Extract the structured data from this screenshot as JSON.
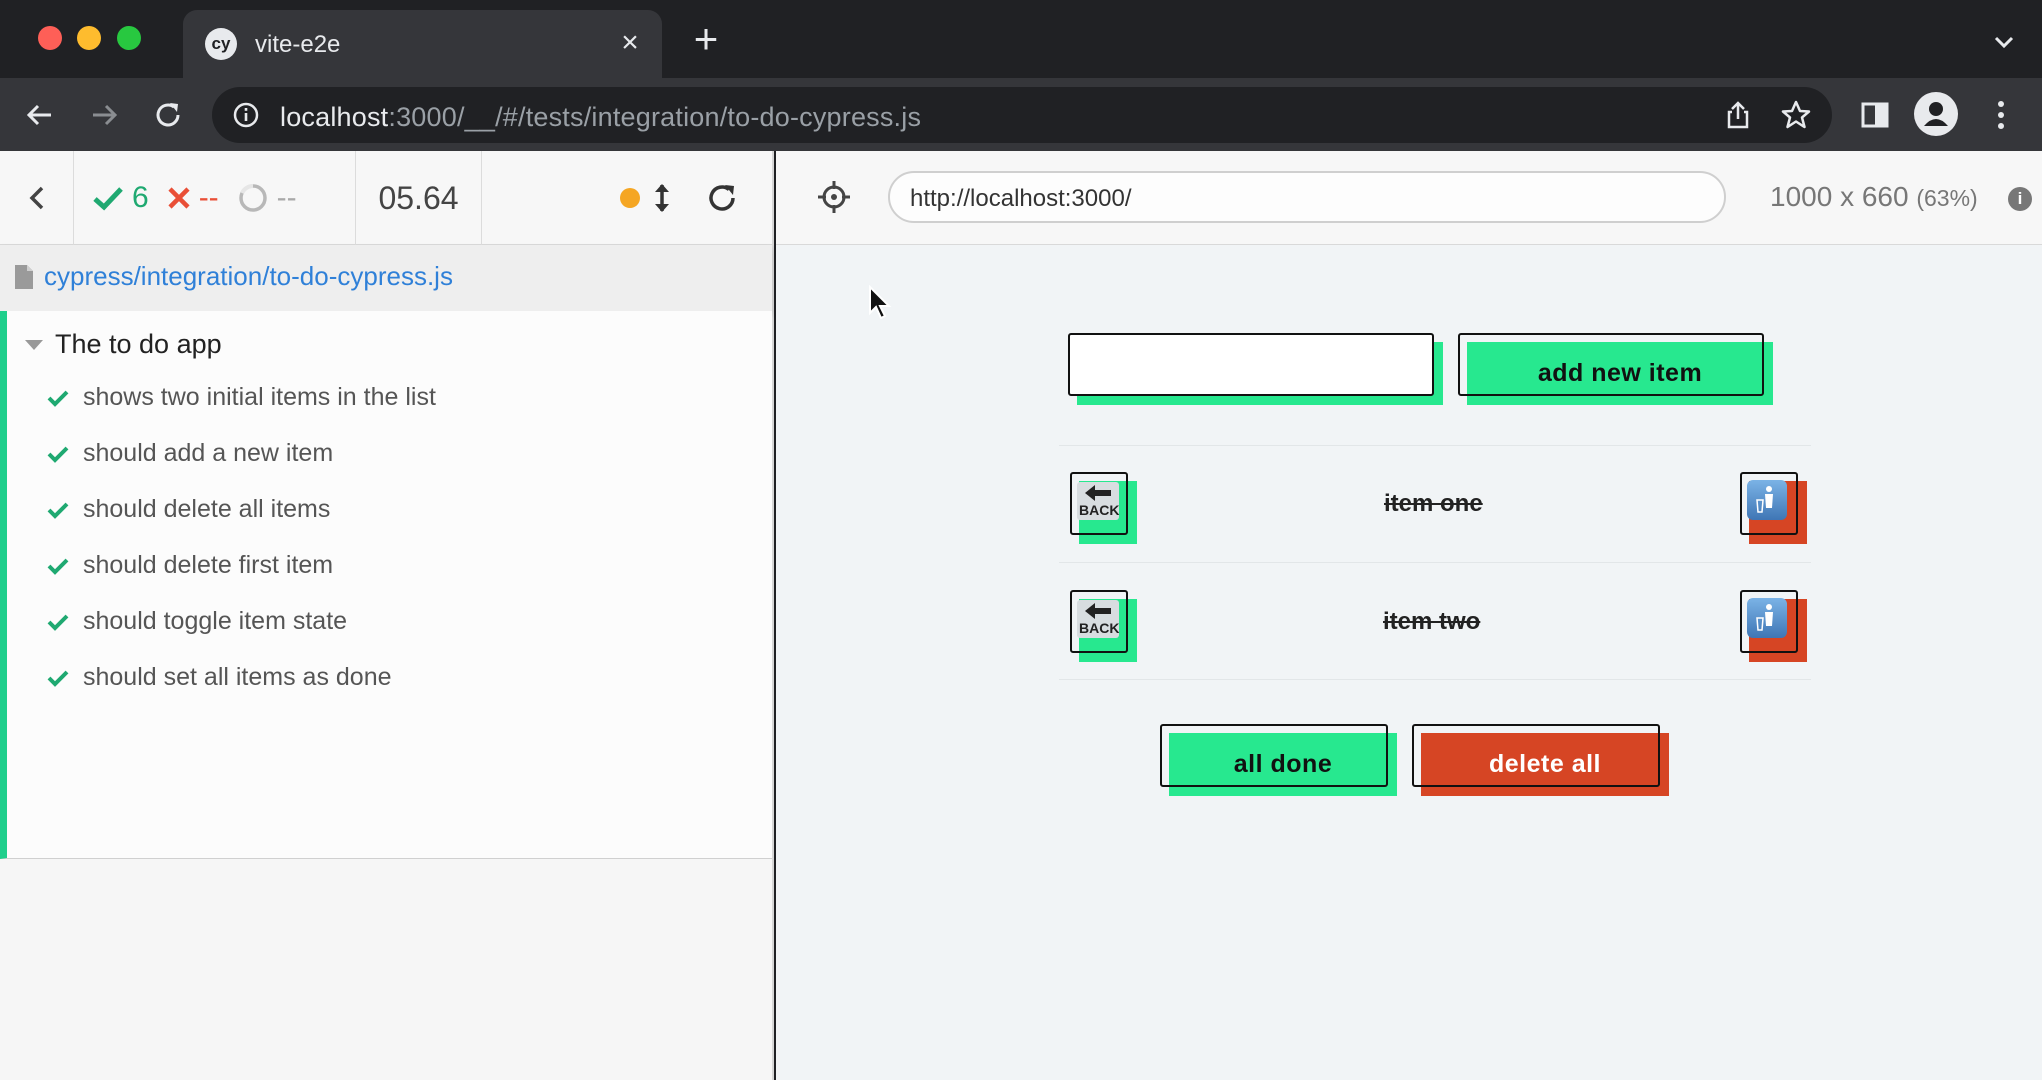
{
  "browser": {
    "tab_title": "vite-e2e",
    "tab_favicon_text": "cy",
    "url_host": "localhost",
    "url_rest": ":3000/__/#/tests/integration/to-do-cypress.js"
  },
  "runner": {
    "passed": "6",
    "failed": "--",
    "pending": "--",
    "duration": "05.64",
    "spec_path": "cypress/integration/to-do-cypress.js",
    "suite_title": "The to do app",
    "tests": [
      {
        "title": "shows two initial items in the list",
        "state": "passed"
      },
      {
        "title": "should add a new item",
        "state": "passed"
      },
      {
        "title": "should delete all items",
        "state": "passed"
      },
      {
        "title": "should delete first item",
        "state": "passed"
      },
      {
        "title": "should toggle item state",
        "state": "passed"
      },
      {
        "title": "should set all items as done",
        "state": "passed"
      }
    ],
    "aut_url": "http://localhost:3000/",
    "viewport_size": "1000 x 660",
    "viewport_scale": "(63%)"
  },
  "app": {
    "new_item_value": "",
    "add_button_label": "add new item",
    "items": [
      {
        "text": "item one",
        "done": true,
        "back_label": "BACK"
      },
      {
        "text": "item two",
        "done": true,
        "back_label": "BACK"
      }
    ],
    "all_done_label": "all done",
    "delete_all_label": "delete all"
  },
  "colors": {
    "pass_green": "#1fa971",
    "fail_red": "#e94f37",
    "app_green": "#27e88f",
    "app_red": "#d64524",
    "link_blue": "#2f80d8"
  }
}
